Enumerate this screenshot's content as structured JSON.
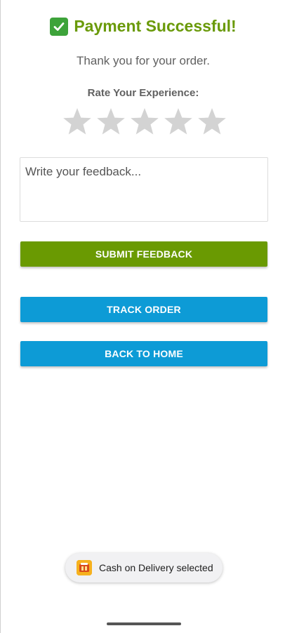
{
  "header": {
    "check_icon": "check-mark-button-icon",
    "title": "Payment Successful!",
    "subtitle": "Thank you for your order."
  },
  "rating": {
    "label": "Rate Your Experience:",
    "max_stars": 5,
    "selected": 0,
    "star_icon": "star-icon",
    "star_color_inactive": "#d3d3d3"
  },
  "feedback": {
    "placeholder": "Write your feedback...",
    "value": ""
  },
  "buttons": {
    "submit_label": "SUBMIT FEEDBACK",
    "track_label": "TRACK ORDER",
    "home_label": "BACK TO HOME"
  },
  "toast": {
    "icon": "app-icon",
    "text": "Cash on Delivery selected"
  },
  "colors": {
    "title": "#6a9a0a",
    "submit_button": "#6a9a02",
    "primary_button": "#0d9bd6",
    "check_icon_bg": "#3da33a"
  }
}
